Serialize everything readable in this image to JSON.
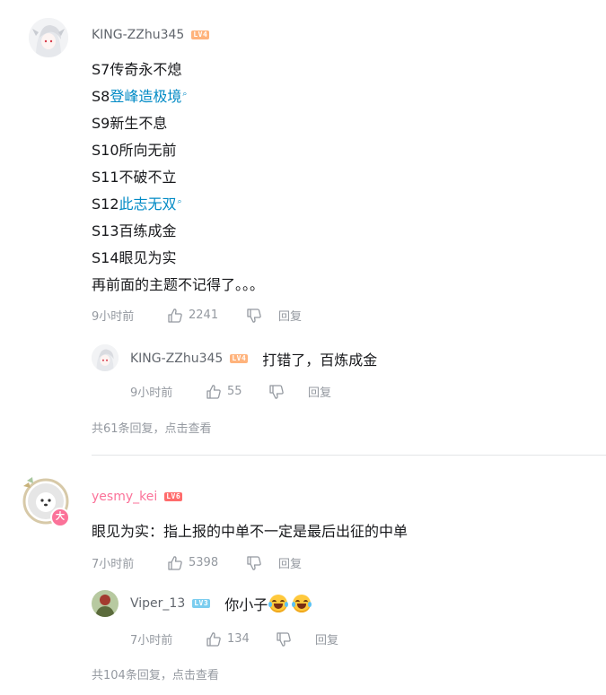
{
  "comments": [
    {
      "user": "KING-ZZhu345",
      "level": "LV4",
      "lines": [
        {
          "prefix": "S7传奇永不熄",
          "link": ""
        },
        {
          "prefix": "S8",
          "link": "登峰造极境"
        },
        {
          "prefix": "S9新生不息",
          "link": ""
        },
        {
          "prefix": "S10所向无前",
          "link": ""
        },
        {
          "prefix": "S11不破不立",
          "link": ""
        },
        {
          "prefix": "S12",
          "link": "此志无双"
        },
        {
          "prefix": "S13百练成金",
          "link": ""
        },
        {
          "prefix": "S14眼见为实",
          "link": ""
        },
        {
          "prefix": "再前面的主题不记得了。。。",
          "link": ""
        }
      ],
      "time": "9小时前",
      "likes": "2241",
      "reply_label": "回复",
      "sub_reply": {
        "user": "KING-ZZhu345",
        "level": "LV4",
        "text": "打错了，百炼成金",
        "time": "9小时前",
        "likes": "55",
        "reply_label": "回复"
      },
      "more_replies": "共61条回复，点击查看"
    },
    {
      "user": "yesmy_kei",
      "level": "LV6",
      "text": "眼见为实：指上报的中单不一定是最后出征的中单",
      "time": "7小时前",
      "likes": "5398",
      "reply_label": "回复",
      "badge": "大",
      "sub_reply": {
        "user": "Viper_13",
        "level": "LV3",
        "text": "你小子",
        "emojis": [
          "laugh-cry-emoji",
          "laugh-cry-emoji"
        ],
        "time": "7小时前",
        "likes": "134",
        "reply_label": "回复"
      },
      "more_replies": "共104条回复，点击查看"
    }
  ],
  "search_mark": "🔍",
  "colors": {
    "link": "#008ac5",
    "muted": "#9499a0",
    "pink_name": "#fb7299"
  }
}
